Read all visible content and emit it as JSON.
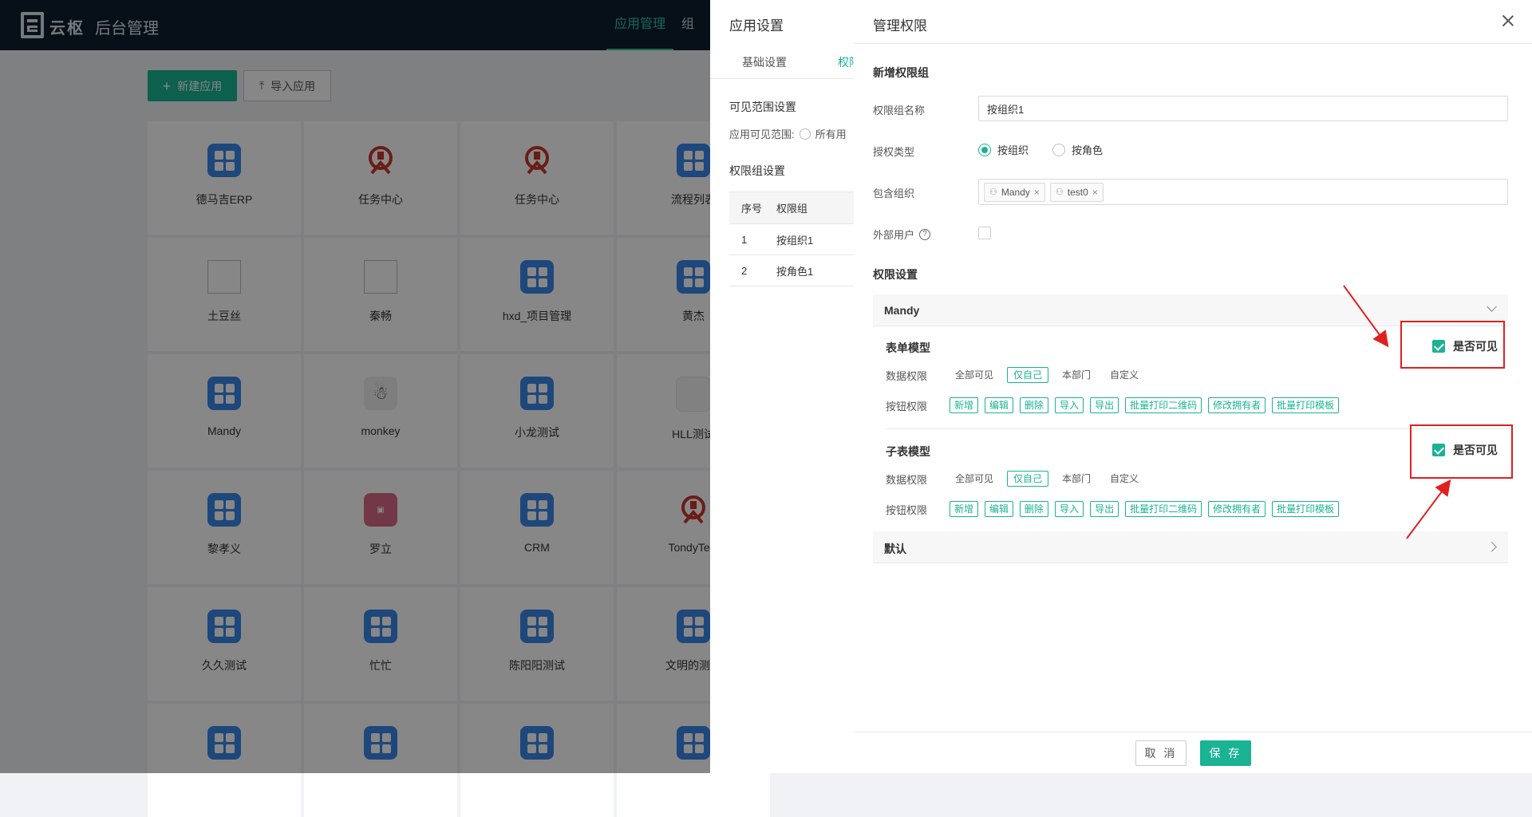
{
  "header": {
    "logo_text": "云枢",
    "app_title": "后台管理",
    "nav": [
      "应用管理",
      "组"
    ]
  },
  "toolbar": {
    "new_app": "新建应用",
    "import_app": "导入应用"
  },
  "apps": [
    {
      "name": "德马吉ERP",
      "icon": "grid"
    },
    {
      "name": "任务中心",
      "icon": "rail"
    },
    {
      "name": "任务中心",
      "icon": "rail"
    },
    {
      "name": "流程列表",
      "icon": "grid"
    },
    {
      "name": "土豆丝",
      "icon": "broken"
    },
    {
      "name": "秦畅",
      "icon": "broken"
    },
    {
      "name": "hxd_项目管理",
      "icon": "grid"
    },
    {
      "name": "黄杰",
      "icon": "grid"
    },
    {
      "name": "Mandy",
      "icon": "grid"
    },
    {
      "name": "monkey",
      "icon": "monkey"
    },
    {
      "name": "小龙测试",
      "icon": "grid"
    },
    {
      "name": "HLL测试",
      "icon": "faint"
    },
    {
      "name": "黎孝义",
      "icon": "grid"
    },
    {
      "name": "罗立",
      "icon": "pink"
    },
    {
      "name": "CRM",
      "icon": "grid"
    },
    {
      "name": "TondyTest",
      "icon": "rail"
    },
    {
      "name": "久久测试",
      "icon": "grid"
    },
    {
      "name": "忙忙",
      "icon": "grid"
    },
    {
      "name": "陈阳阳测试",
      "icon": "grid"
    },
    {
      "name": "文明的测试",
      "icon": "grid"
    },
    {
      "name": "",
      "icon": "grid"
    },
    {
      "name": "",
      "icon": "grid"
    },
    {
      "name": "",
      "icon": "grid"
    },
    {
      "name": "",
      "icon": "grid"
    }
  ],
  "app_settings": {
    "title": "应用设置",
    "tabs": [
      "基础设置",
      "权限"
    ],
    "visible_scope_title": "可见范围设置",
    "visible_scope_label": "应用可见范围:",
    "visible_scope_option": "所有用",
    "perm_group_title": "权限组设置",
    "table_headers": [
      "序号",
      "权限组"
    ],
    "rows": [
      [
        "1",
        "按组织1"
      ],
      [
        "2",
        "按角色1"
      ]
    ]
  },
  "manage": {
    "title": "管理权限",
    "new_group_title": "新增权限组",
    "name_label": "权限组名称",
    "name_value": "按组织1",
    "type_label": "授权类型",
    "type_options": [
      "按组织",
      "按角色"
    ],
    "type_selected": "按组织",
    "include_label": "包含组织",
    "include_tags": [
      "Mandy",
      "test0"
    ],
    "external_label": "外部用户",
    "perm_settings_title": "权限设置",
    "group1": "Mandy",
    "group2": "默认",
    "models": [
      {
        "name": "表单模型",
        "visible_label": "是否可见",
        "visible": true,
        "data_label": "数据权限",
        "data_options": [
          "全部可见",
          "仅自己",
          "本部门",
          "自定义"
        ],
        "data_selected": "仅自己",
        "button_label": "按钮权限",
        "buttons": [
          "新增",
          "编辑",
          "删除",
          "导入",
          "导出",
          "批量打印二维码",
          "修改拥有者",
          "批量打印模板"
        ]
      },
      {
        "name": "子表模型",
        "visible_label": "是否可见",
        "visible": true,
        "data_label": "数据权限",
        "data_options": [
          "全部可见",
          "仅自己",
          "本部门",
          "自定义"
        ],
        "data_selected": "仅自己",
        "button_label": "按钮权限",
        "buttons": [
          "新增",
          "编辑",
          "删除",
          "导入",
          "导出",
          "批量打印二维码",
          "修改拥有者",
          "批量打印模板"
        ]
      }
    ],
    "cancel": "取 消",
    "save": "保 存"
  },
  "colors": {
    "accent": "#1ab394",
    "annotation": "#e02020",
    "topbar": "#0f1d30"
  }
}
